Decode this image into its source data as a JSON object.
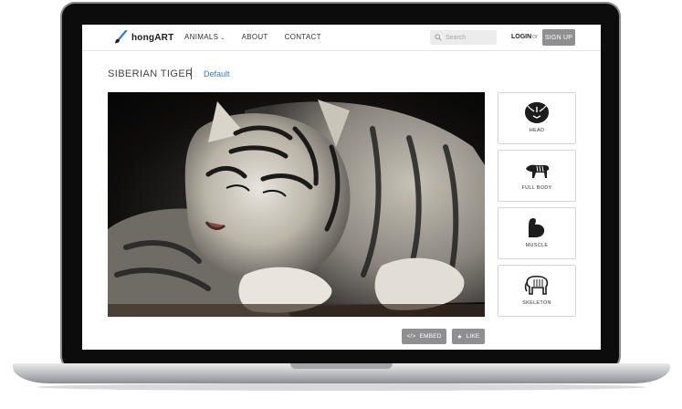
{
  "header": {
    "logo_text": "hongART",
    "nav": [
      {
        "label": "ANIMALS",
        "has_dropdown": true
      },
      {
        "label": "ABOUT"
      },
      {
        "label": "CONTACT"
      }
    ],
    "search_placeholder": "Search",
    "login_label": "LOGIN",
    "or_label": "or",
    "signup_label": "SIGN UP"
  },
  "page": {
    "title": "SIBERIAN TIGER",
    "variant_link": "Default"
  },
  "views": [
    {
      "label": "HEAD",
      "icon": "tiger-head-icon"
    },
    {
      "label": "FULL BODY",
      "icon": "tiger-body-icon"
    },
    {
      "label": "MUSCLE",
      "icon": "muscle-arm-icon"
    },
    {
      "label": "SKELETON",
      "icon": "elephant-skeleton-icon"
    }
  ],
  "actions": {
    "embed_label": "EMBED",
    "like_label": "LIKE"
  },
  "colors": {
    "accent_link": "#2a7fc1",
    "button_gray": "#8f8f91"
  }
}
